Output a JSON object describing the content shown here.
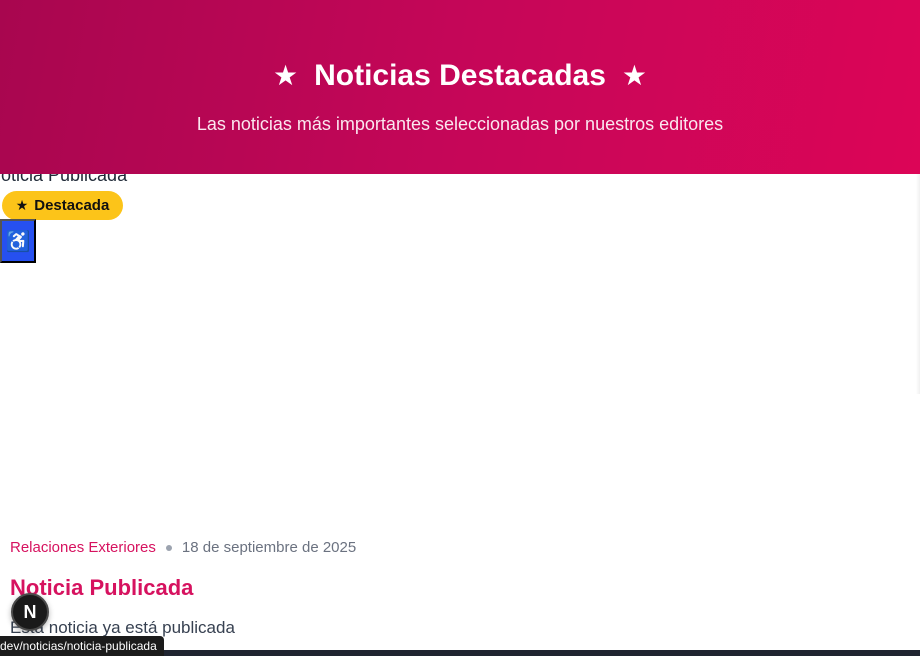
{
  "hero": {
    "star": "★",
    "title": "Noticias Destacadas",
    "subtitle": "Las noticias más importantes seleccionadas por nuestros editores"
  },
  "peek_card": {
    "title": "Noticia Publicada",
    "badge_label": "Destacada",
    "badge_icon": "star-icon"
  },
  "accessibility": {
    "icon": "accessibility-icon",
    "glyph": "♿"
  },
  "article": {
    "category": "Relaciones Exteriores",
    "date": "18 de septiembre de 2025",
    "title": "Noticia Publicada",
    "excerpt": "Esta noticia ya está publicada"
  },
  "dev_indicator": {
    "label": "N"
  },
  "status_bar": {
    "url": "dev/noticias/noticia-publicada"
  },
  "colors": {
    "hero_start": "#a8064f",
    "hero_end": "#dc0557",
    "accent": "#d6125f",
    "badge": "#fcc419",
    "a11y": "#2650f0"
  }
}
